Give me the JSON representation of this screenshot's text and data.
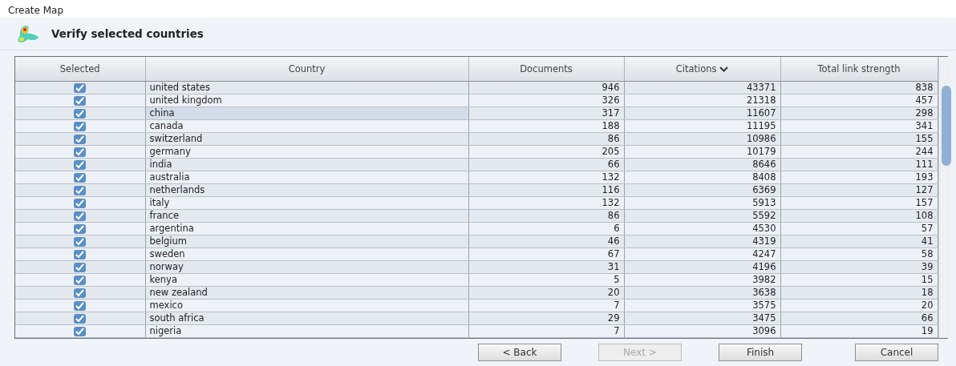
{
  "window": {
    "title": "Create Map"
  },
  "header": {
    "title": "Verify selected countries"
  },
  "table": {
    "columns": [
      {
        "label": "Selected",
        "sorted": false
      },
      {
        "label": "Country",
        "sorted": false
      },
      {
        "label": "Documents",
        "sorted": false
      },
      {
        "label": "Citations",
        "sorted": true
      },
      {
        "label": "Total link strength",
        "sorted": false
      }
    ],
    "rows": [
      {
        "checked": true,
        "selected": false,
        "country": "united states",
        "documents": "946",
        "citations": "43371",
        "strength": "838"
      },
      {
        "checked": true,
        "selected": false,
        "country": "united kingdom",
        "documents": "326",
        "citations": "21318",
        "strength": "457"
      },
      {
        "checked": true,
        "selected": true,
        "country": "china",
        "documents": "317",
        "citations": "11607",
        "strength": "298"
      },
      {
        "checked": true,
        "selected": false,
        "country": "canada",
        "documents": "188",
        "citations": "11195",
        "strength": "341"
      },
      {
        "checked": true,
        "selected": false,
        "country": "switzerland",
        "documents": "86",
        "citations": "10986",
        "strength": "155"
      },
      {
        "checked": true,
        "selected": false,
        "country": "germany",
        "documents": "205",
        "citations": "10179",
        "strength": "244"
      },
      {
        "checked": true,
        "selected": false,
        "country": "india",
        "documents": "66",
        "citations": "8646",
        "strength": "111"
      },
      {
        "checked": true,
        "selected": false,
        "country": "australia",
        "documents": "132",
        "citations": "8408",
        "strength": "193"
      },
      {
        "checked": true,
        "selected": false,
        "country": "netherlands",
        "documents": "116",
        "citations": "6369",
        "strength": "127"
      },
      {
        "checked": true,
        "selected": false,
        "country": "italy",
        "documents": "132",
        "citations": "5913",
        "strength": "157"
      },
      {
        "checked": true,
        "selected": false,
        "country": "france",
        "documents": "86",
        "citations": "5592",
        "strength": "108"
      },
      {
        "checked": true,
        "selected": false,
        "country": "argentina",
        "documents": "6",
        "citations": "4530",
        "strength": "57"
      },
      {
        "checked": true,
        "selected": false,
        "country": "belgium",
        "documents": "46",
        "citations": "4319",
        "strength": "41"
      },
      {
        "checked": true,
        "selected": false,
        "country": "sweden",
        "documents": "67",
        "citations": "4247",
        "strength": "58"
      },
      {
        "checked": true,
        "selected": false,
        "country": "norway",
        "documents": "31",
        "citations": "4196",
        "strength": "39"
      },
      {
        "checked": true,
        "selected": false,
        "country": "kenya",
        "documents": "5",
        "citations": "3982",
        "strength": "15"
      },
      {
        "checked": true,
        "selected": false,
        "country": "new zealand",
        "documents": "20",
        "citations": "3638",
        "strength": "18"
      },
      {
        "checked": true,
        "selected": false,
        "country": "mexico",
        "documents": "7",
        "citations": "3575",
        "strength": "20"
      },
      {
        "checked": true,
        "selected": false,
        "country": "south africa",
        "documents": "29",
        "citations": "3475",
        "strength": "66"
      },
      {
        "checked": true,
        "selected": false,
        "country": "nigeria",
        "documents": "7",
        "citations": "3096",
        "strength": "19"
      }
    ]
  },
  "buttons": [
    {
      "label": "< Back",
      "disabled": false
    },
    {
      "label": "Next >",
      "disabled": true
    },
    {
      "label": "Finish",
      "disabled": false
    },
    {
      "label": "Cancel",
      "disabled": false
    }
  ]
}
